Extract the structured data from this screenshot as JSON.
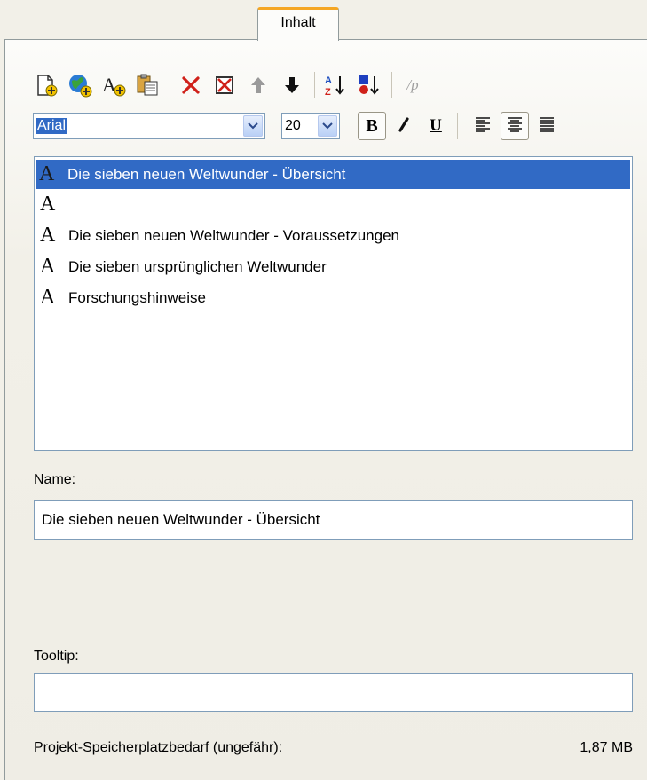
{
  "tab": {
    "label": "Inhalt"
  },
  "toolbar": {
    "buttons": [
      {
        "icon": "new-page-icon"
      },
      {
        "icon": "globe-add-icon"
      },
      {
        "icon": "font-add-icon"
      },
      {
        "icon": "paste-icon"
      },
      {
        "icon": "delete-icon"
      },
      {
        "icon": "delete-all-icon"
      },
      {
        "icon": "arrow-up-icon"
      },
      {
        "icon": "arrow-down-icon"
      },
      {
        "icon": "sort-az-icon"
      },
      {
        "icon": "sort-color-icon"
      },
      {
        "icon": "paragraph-icon",
        "text": "/p"
      }
    ]
  },
  "format": {
    "font": "Arial",
    "size": "20",
    "bold_label": "B",
    "underline_label": "U"
  },
  "list": {
    "items": [
      {
        "label": "Die sieben neuen Weltwunder - Übersicht",
        "selected": true
      },
      {
        "label": ""
      },
      {
        "label": "Die sieben neuen Weltwunder - Voraussetzungen"
      },
      {
        "label": "Die sieben ursprünglichen Weltwunder"
      },
      {
        "label": "Forschungshinweise"
      }
    ],
    "glyph": "A"
  },
  "name": {
    "label": "Name:",
    "value": "Die sieben neuen Weltwunder - Übersicht"
  },
  "tooltip": {
    "label": "Tooltip:",
    "value": ""
  },
  "footer": {
    "label": "Projekt-Speicherplatzbedarf (ungefähr):",
    "value": "1,87 MB"
  },
  "colors": {
    "selection": "#316ac5",
    "tab_accent": "#f5a623",
    "delete_red": "#d0211a"
  }
}
